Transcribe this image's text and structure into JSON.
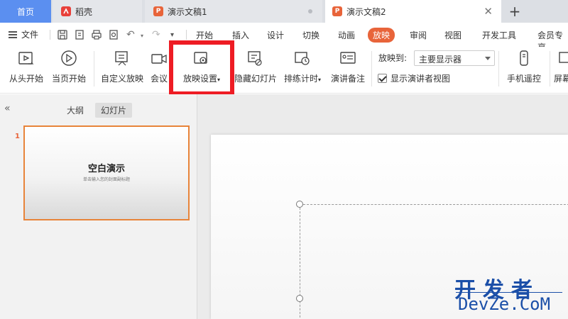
{
  "tabs": [
    {
      "label": "首页"
    },
    {
      "label": "稻壳"
    },
    {
      "label": "演示文稿1"
    },
    {
      "label": "演示文稿2"
    }
  ],
  "menubar": {
    "file_label": "文件",
    "items": [
      "开始",
      "插入",
      "设计",
      "切换",
      "动画",
      "放映",
      "审阅",
      "视图",
      "开发工具",
      "会员专享"
    ],
    "active": "放映"
  },
  "ribbon": {
    "buttons": [
      "从头开始",
      "当页开始",
      "自定义放映",
      "会议",
      "放映设置",
      "隐藏幻灯片",
      "排练计时",
      "演讲备注",
      "手机遥控",
      "屏幕"
    ],
    "play_to_label": "放映到:",
    "display_select": "主要显示器",
    "presenter_view_label": "显示演讲者视图",
    "presenter_view_checked": true
  },
  "leftpane": {
    "tabs": [
      "大纲",
      "幻灯片"
    ],
    "active_tab": "幻灯片",
    "slides": [
      {
        "number": "1",
        "title": "空白演示",
        "subtitle": "单击输入您的封面副标题"
      }
    ]
  },
  "watermark": {
    "line1": "开发者",
    "line2": "DevZe.CoM"
  },
  "colors": {
    "accent": "#e8643a",
    "home_tab": "#5b8ff0",
    "highlight_box": "#ee1c24"
  }
}
